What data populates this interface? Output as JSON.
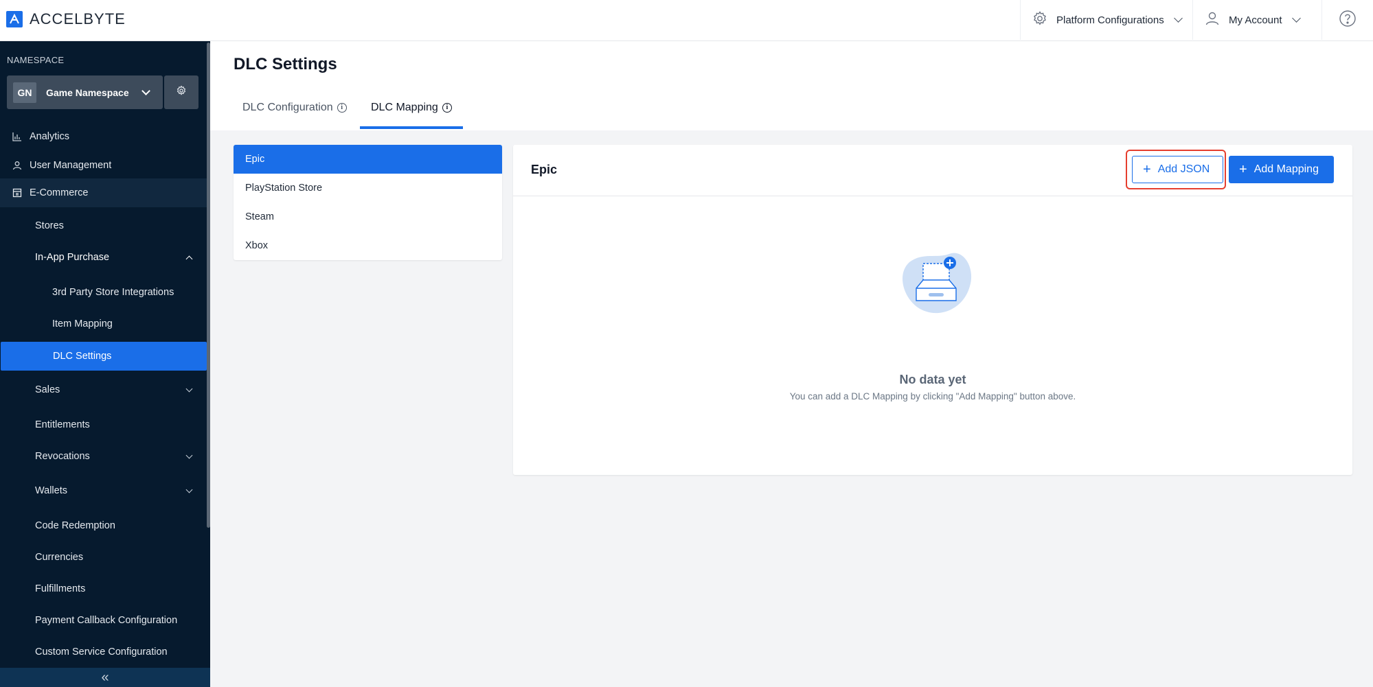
{
  "brand": {
    "name": "ACCELBYTE",
    "color": "#1a6ee8"
  },
  "topbar": {
    "platform_label": "Platform Configurations",
    "account_label": "My Account"
  },
  "sidebar": {
    "namespace_label": "NAMESPACE",
    "namespace_badge": "GN",
    "namespace_name": "Game Namespace",
    "items": {
      "analytics": "Analytics",
      "user_management": "User Management",
      "ecommerce": "E-Commerce",
      "stores": "Stores",
      "in_app_purchase": "In-App Purchase",
      "third_party": "3rd Party Store Integrations",
      "item_mapping": "Item Mapping",
      "dlc_settings": "DLC Settings",
      "sales": "Sales",
      "entitlements": "Entitlements",
      "revocations": "Revocations",
      "wallets": "Wallets",
      "code_redemption": "Code Redemption",
      "currencies": "Currencies",
      "fulfillments": "Fulfillments",
      "payment_callback": "Payment Callback Configuration",
      "custom_service": "Custom Service Configuration"
    },
    "collapse_glyph": "«"
  },
  "main": {
    "title": "DLC Settings",
    "tabs": {
      "config": "DLC Configuration",
      "mapping": "DLC Mapping"
    },
    "info_glyph": "i",
    "platforms": [
      "Epic",
      "PlayStation Store",
      "Steam",
      "Xbox"
    ],
    "panel": {
      "title": "Epic",
      "add_json": "Add JSON",
      "add_mapping": "Add Mapping",
      "plus_glyph": "+",
      "empty_title": "No data yet",
      "empty_subtitle": "You can add a DLC Mapping by clicking \"Add Mapping\" button above."
    }
  }
}
